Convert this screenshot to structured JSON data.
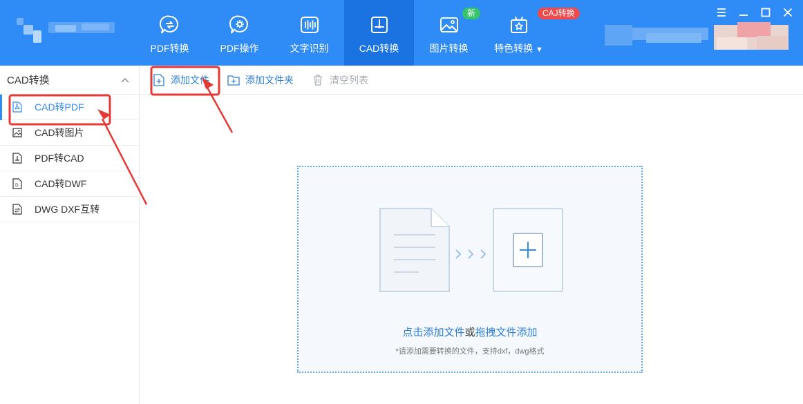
{
  "header": {
    "nav": [
      {
        "label": "PDF转换",
        "icon": "pdf-convert-icon"
      },
      {
        "label": "PDF操作",
        "icon": "pdf-operation-icon"
      },
      {
        "label": "文字识别",
        "icon": "text-recognition-icon"
      },
      {
        "label": "CAD转换",
        "icon": "cad-convert-icon",
        "active": true
      },
      {
        "label": "图片转换",
        "icon": "image-convert-icon",
        "badge": "新"
      },
      {
        "label": "特色转换",
        "icon": "special-convert-icon",
        "badge": "CAJ转换",
        "dropdown": true
      }
    ]
  },
  "sidebar": {
    "title": "CAD转换",
    "items": [
      {
        "label": "CAD转PDF",
        "icon": "pdf-file-icon",
        "active": true
      },
      {
        "label": "CAD转图片",
        "icon": "image-file-icon"
      },
      {
        "label": "PDF转CAD",
        "icon": "cad-file-icon"
      },
      {
        "label": "CAD转DWF",
        "icon": "dwf-file-icon"
      },
      {
        "label": "DWG DXF互转",
        "icon": "swap-file-icon"
      }
    ]
  },
  "toolbar": {
    "add_file": "添加文件",
    "add_folder": "添加文件夹",
    "clear_list": "清空列表"
  },
  "dropzone": {
    "click_add": "点击添加文件",
    "or": "或",
    "drag_add": "拖拽文件添加",
    "hint": "*请添加需要转换的文件，支持dxf，dwg格式"
  },
  "colors": {
    "header_bg": "#2f8bf5",
    "active_tab_bg": "#1a73e0",
    "accent": "#2f7fd6",
    "annotation_red": "#e53935",
    "badge_new": "#35c46a",
    "badge_caj": "#f04a4a"
  }
}
